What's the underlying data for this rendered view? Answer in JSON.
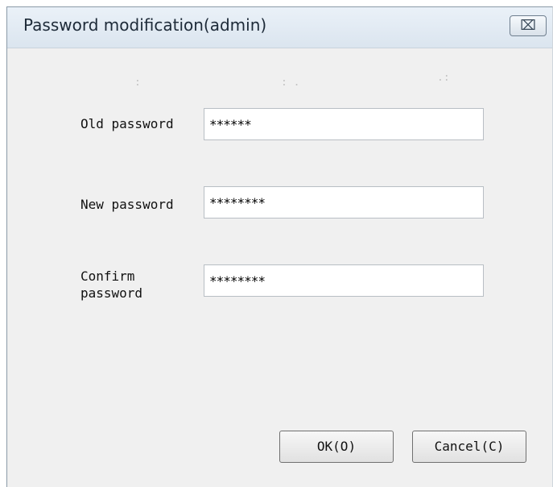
{
  "window": {
    "title": "Password modification(admin)",
    "close_icon": "close-icon",
    "close_glyph": "⌧"
  },
  "form": {
    "old_password": {
      "label": "Old password",
      "value": "******"
    },
    "new_password": {
      "label": "New password",
      "value": "********"
    },
    "confirm_password": {
      "label": "Confirm\npassword",
      "value": "********"
    }
  },
  "buttons": {
    "ok_label": "OK(O)",
    "cancel_label": "Cancel(C)"
  }
}
